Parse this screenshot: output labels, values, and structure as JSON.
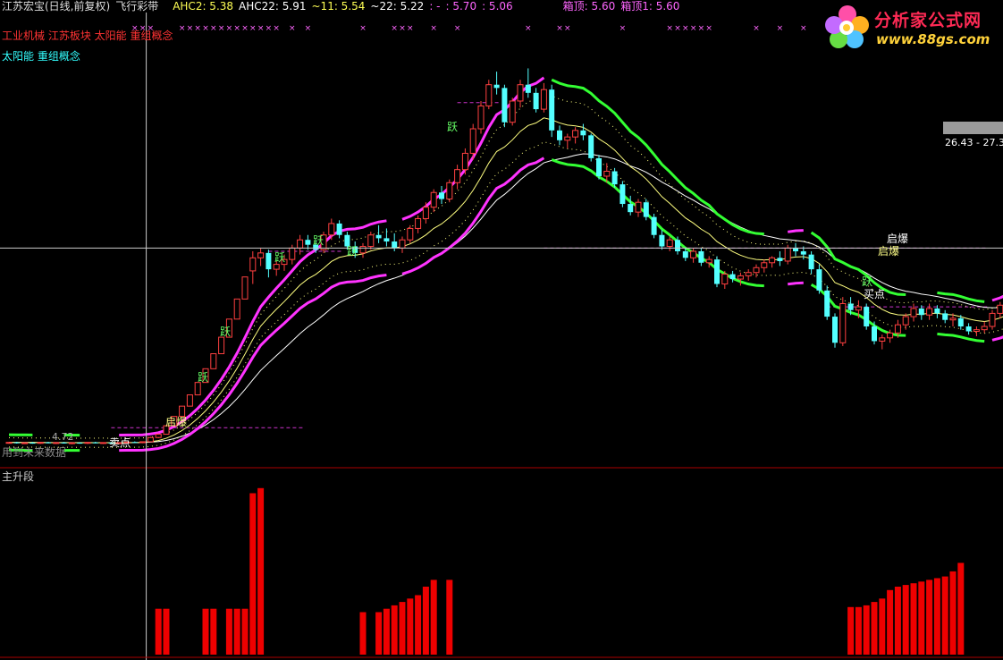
{
  "header": {
    "title": "江苏宏宝(日线,前复权)",
    "indicator": "飞行彩带",
    "ahc2": "AHC2: 5.38",
    "ahc22": "AHC22: 5.91",
    "v11": "~11: 5.54",
    "v22": "~22: 5.22",
    "dash1": ": -",
    "val570": ": 5.70",
    "val506": ": 5.06",
    "box_top": "箱顶: 5.60",
    "box_top1": "箱顶1: 5.60"
  },
  "concepts": {
    "line1": "工业机械 江苏板块 太阳能 重组概念",
    "line2": "太阳能 重组概念"
  },
  "notes": {
    "future_data": "用到未来数据",
    "start_price": "4.72",
    "price_range": "26.43 - 27.3"
  },
  "signals": {
    "jump": "跃",
    "start_burst": "启爆",
    "buy_point": "买点",
    "sell_point": "卖点"
  },
  "sub_panel": {
    "title": "主升段"
  },
  "logo": {
    "name": "分析家公式网",
    "url": "www.88gs.com"
  },
  "colors": {
    "background": "#000000",
    "up_candle": "#ff4040",
    "down_candle": "#54ffff",
    "band_upper": "#ff33ff",
    "band_fast": "#ffff80",
    "band_slow": "#ffffff",
    "band_green": "#33ff33",
    "bars": "#ee0000",
    "box_line": "#cc33cc"
  },
  "chart_data": {
    "type": "candlestick",
    "x_count": 125,
    "ylim": [
      4.3,
      28.5
    ],
    "ohlc": [
      [
        4.65,
        4.72,
        4.62,
        4.7
      ],
      [
        4.7,
        4.74,
        4.63,
        4.66
      ],
      [
        4.66,
        4.72,
        4.6,
        4.68
      ],
      [
        4.68,
        4.73,
        4.62,
        4.67
      ],
      [
        4.67,
        4.72,
        4.61,
        4.7
      ],
      [
        4.7,
        4.74,
        4.64,
        4.66
      ],
      [
        4.66,
        4.71,
        4.6,
        4.69
      ],
      [
        4.69,
        4.73,
        4.63,
        4.65
      ],
      [
        4.65,
        4.7,
        4.59,
        4.68
      ],
      [
        4.68,
        4.72,
        4.62,
        4.66
      ],
      [
        4.66,
        4.71,
        4.6,
        4.7
      ],
      [
        4.7,
        4.74,
        4.64,
        4.67
      ],
      [
        4.67,
        4.71,
        4.61,
        4.69
      ],
      [
        4.69,
        4.73,
        4.63,
        4.66
      ],
      [
        4.66,
        4.7,
        4.6,
        4.68
      ],
      [
        4.68,
        4.72,
        4.62,
        4.72
      ],
      [
        4.72,
        4.76,
        4.66,
        4.7
      ],
      [
        4.7,
        4.75,
        4.65,
        4.74
      ],
      [
        4.74,
        5.05,
        4.72,
        5.0
      ],
      [
        5.0,
        5.25,
        4.96,
        5.2
      ],
      [
        5.2,
        5.72,
        5.18,
        5.72
      ],
      [
        5.72,
        6.29,
        5.72,
        6.29
      ],
      [
        6.29,
        6.92,
        6.29,
        6.92
      ],
      [
        6.92,
        7.61,
        6.92,
        7.61
      ],
      [
        7.61,
        8.37,
        7.61,
        8.37
      ],
      [
        8.37,
        9.21,
        8.37,
        9.21
      ],
      [
        9.21,
        10.13,
        9.21,
        10.13
      ],
      [
        10.13,
        11.14,
        10.13,
        11.14
      ],
      [
        11.14,
        12.25,
        11.14,
        12.25
      ],
      [
        12.25,
        13.48,
        12.25,
        13.48
      ],
      [
        13.48,
        14.83,
        13.48,
        14.83
      ],
      [
        15.2,
        16.4,
        14.4,
        16.0
      ],
      [
        16.0,
        16.6,
        15.5,
        16.3
      ],
      [
        16.3,
        16.5,
        14.8,
        15.3
      ],
      [
        15.3,
        15.8,
        14.9,
        15.6
      ],
      [
        15.6,
        16.2,
        15.2,
        15.9
      ],
      [
        15.9,
        16.8,
        15.6,
        16.6
      ],
      [
        16.6,
        17.4,
        16.2,
        17.1
      ],
      [
        17.1,
        17.4,
        16.5,
        16.8
      ],
      [
        16.8,
        17.1,
        16.3,
        16.5
      ],
      [
        16.5,
        17.6,
        16.3,
        17.4
      ],
      [
        17.4,
        18.4,
        17.1,
        18.1
      ],
      [
        18.1,
        18.3,
        17.2,
        17.4
      ],
      [
        17.4,
        17.6,
        16.5,
        16.7
      ],
      [
        16.7,
        17.0,
        16.0,
        16.3
      ],
      [
        16.3,
        16.9,
        16.0,
        16.7
      ],
      [
        16.7,
        17.6,
        16.5,
        17.4
      ],
      [
        17.4,
        18.0,
        16.9,
        17.2
      ],
      [
        17.2,
        17.8,
        16.7,
        17.0
      ],
      [
        17.0,
        17.5,
        16.4,
        16.6
      ],
      [
        16.6,
        17.3,
        16.3,
        17.1
      ],
      [
        17.1,
        18.0,
        16.9,
        17.8
      ],
      [
        17.8,
        18.6,
        17.5,
        18.4
      ],
      [
        18.4,
        19.4,
        18.1,
        19.1
      ],
      [
        19.1,
        20.2,
        18.8,
        20.0
      ],
      [
        20.0,
        20.4,
        19.3,
        19.6
      ],
      [
        19.6,
        20.8,
        19.4,
        20.6
      ],
      [
        20.6,
        21.7,
        20.2,
        21.4
      ],
      [
        21.4,
        22.7,
        21.1,
        22.4
      ],
      [
        22.4,
        24.2,
        22.0,
        23.9
      ],
      [
        23.9,
        25.6,
        23.6,
        25.3
      ],
      [
        25.3,
        26.9,
        25.1,
        26.6
      ],
      [
        26.6,
        27.4,
        26.0,
        26.4
      ],
      [
        26.4,
        26.6,
        24.0,
        24.3
      ],
      [
        24.3,
        25.8,
        24.1,
        25.6
      ],
      [
        25.6,
        26.9,
        25.2,
        26.6
      ],
      [
        26.6,
        27.6,
        25.8,
        26.1
      ],
      [
        26.1,
        26.4,
        24.9,
        25.1
      ],
      [
        25.1,
        26.7,
        24.9,
        26.3
      ],
      [
        26.3,
        26.6,
        23.4,
        23.8
      ],
      [
        23.8,
        24.1,
        22.9,
        23.2
      ],
      [
        23.2,
        23.6,
        22.7,
        23.4
      ],
      [
        23.4,
        24.0,
        23.0,
        23.8
      ],
      [
        23.8,
        24.2,
        23.2,
        23.5
      ],
      [
        23.5,
        23.6,
        21.9,
        22.1
      ],
      [
        22.1,
        22.3,
        20.8,
        21.0
      ],
      [
        21.0,
        21.8,
        20.6,
        21.3
      ],
      [
        21.3,
        21.5,
        20.3,
        20.5
      ],
      [
        20.5,
        20.7,
        19.1,
        19.3
      ],
      [
        19.3,
        19.8,
        18.6,
        18.8
      ],
      [
        18.8,
        19.6,
        18.5,
        19.4
      ],
      [
        19.4,
        19.6,
        18.3,
        18.5
      ],
      [
        18.5,
        18.7,
        17.2,
        17.4
      ],
      [
        17.4,
        17.7,
        16.5,
        16.7
      ],
      [
        16.7,
        17.3,
        16.4,
        17.1
      ],
      [
        17.1,
        17.3,
        16.2,
        16.4
      ],
      [
        16.4,
        16.6,
        15.8,
        16.0
      ],
      [
        16.0,
        16.6,
        15.7,
        16.4
      ],
      [
        16.4,
        16.6,
        15.5,
        15.7
      ],
      [
        15.7,
        16.1,
        15.4,
        15.9
      ],
      [
        15.9,
        16.1,
        14.2,
        14.4
      ],
      [
        14.4,
        15.2,
        14.1,
        15.0
      ],
      [
        15.0,
        15.2,
        14.5,
        14.7
      ],
      [
        14.7,
        15.1,
        14.3,
        14.9
      ],
      [
        14.9,
        15.3,
        14.6,
        15.1
      ],
      [
        15.1,
        15.6,
        14.8,
        15.4
      ],
      [
        15.4,
        15.9,
        15.1,
        15.7
      ],
      [
        15.7,
        16.1,
        15.4,
        16.0
      ],
      [
        16.0,
        16.4,
        15.5,
        15.8
      ],
      [
        15.8,
        16.8,
        15.6,
        16.6
      ],
      [
        16.6,
        16.9,
        16.1,
        16.4
      ],
      [
        16.4,
        16.7,
        15.9,
        16.2
      ],
      [
        16.2,
        16.4,
        15.0,
        15.3
      ],
      [
        15.3,
        15.6,
        13.8,
        14.0
      ],
      [
        14.0,
        14.3,
        12.2,
        12.4
      ],
      [
        12.4,
        12.6,
        10.5,
        10.8
      ],
      [
        10.8,
        13.6,
        10.6,
        13.2
      ],
      [
        13.2,
        13.6,
        12.5,
        12.8
      ],
      [
        12.8,
        13.4,
        12.3,
        13.0
      ],
      [
        13.0,
        13.2,
        11.6,
        11.8
      ],
      [
        11.8,
        12.1,
        10.7,
        10.9
      ],
      [
        10.9,
        11.3,
        10.4,
        11.1
      ],
      [
        11.1,
        11.6,
        10.8,
        11.4
      ],
      [
        11.4,
        12.2,
        11.1,
        11.9
      ],
      [
        11.9,
        12.6,
        11.6,
        12.4
      ],
      [
        12.4,
        13.2,
        12.1,
        12.9
      ],
      [
        12.9,
        13.1,
        12.2,
        12.5
      ],
      [
        12.5,
        13.2,
        12.2,
        12.9
      ],
      [
        12.9,
        13.1,
        12.3,
        12.6
      ],
      [
        12.6,
        12.8,
        12.0,
        12.2
      ],
      [
        12.2,
        12.6,
        11.8,
        12.3
      ],
      [
        12.3,
        12.5,
        11.6,
        11.8
      ],
      [
        11.8,
        12.0,
        11.3,
        11.5
      ],
      [
        11.5,
        11.8,
        11.2,
        11.6
      ],
      [
        11.6,
        12.1,
        11.4,
        11.8
      ],
      [
        11.8,
        12.8,
        11.6,
        12.6
      ],
      [
        12.6,
        13.3,
        12.3,
        13.1
      ],
      [
        13.1,
        13.9,
        12.9,
        13.6
      ],
      [
        13.6,
        14.8,
        13.4,
        14.5
      ]
    ],
    "box_levels": [
      {
        "value": 5.6,
        "from": 13,
        "to": 37
      },
      {
        "value": 16.4,
        "from": 33,
        "to": 42
      },
      {
        "value": 25.5,
        "from": 57,
        "to": 62
      },
      {
        "value": 16.6,
        "from": 68,
        "to": 124
      },
      {
        "value": 13.0,
        "from": 104,
        "to": 124
      }
    ],
    "sub_bars": [
      {
        "i": 19,
        "v": 0.27
      },
      {
        "i": 20,
        "v": 0.27
      },
      {
        "i": 25,
        "v": 0.27
      },
      {
        "i": 26,
        "v": 0.27
      },
      {
        "i": 28,
        "v": 0.27
      },
      {
        "i": 29,
        "v": 0.27
      },
      {
        "i": 30,
        "v": 0.27
      },
      {
        "i": 31,
        "v": 0.95
      },
      {
        "i": 32,
        "v": 0.98
      },
      {
        "i": 45,
        "v": 0.25
      },
      {
        "i": 47,
        "v": 0.25
      },
      {
        "i": 48,
        "v": 0.27
      },
      {
        "i": 49,
        "v": 0.29
      },
      {
        "i": 50,
        "v": 0.31
      },
      {
        "i": 51,
        "v": 0.33
      },
      {
        "i": 52,
        "v": 0.35
      },
      {
        "i": 53,
        "v": 0.4
      },
      {
        "i": 54,
        "v": 0.44
      },
      {
        "i": 56,
        "v": 0.44
      },
      {
        "i": 107,
        "v": 0.28
      },
      {
        "i": 108,
        "v": 0.28
      },
      {
        "i": 109,
        "v": 0.29
      },
      {
        "i": 110,
        "v": 0.31
      },
      {
        "i": 111,
        "v": 0.33
      },
      {
        "i": 112,
        "v": 0.38
      },
      {
        "i": 113,
        "v": 0.4
      },
      {
        "i": 114,
        "v": 0.41
      },
      {
        "i": 115,
        "v": 0.42
      },
      {
        "i": 116,
        "v": 0.43
      },
      {
        "i": 117,
        "v": 0.44
      },
      {
        "i": 118,
        "v": 0.45
      },
      {
        "i": 119,
        "v": 0.46
      },
      {
        "i": 120,
        "v": 0.49
      },
      {
        "i": 121,
        "v": 0.54
      }
    ],
    "signals": [
      {
        "i": 13,
        "label": "卖点"
      },
      {
        "i": 20,
        "label": "启爆"
      },
      {
        "i": 24,
        "label": "跃"
      },
      {
        "i": 27,
        "label": "跃"
      },
      {
        "i": 35,
        "label": "跃"
      },
      {
        "i": 40,
        "label": "跃"
      },
      {
        "i": 43,
        "label": "跃"
      },
      {
        "i": 56,
        "label": "跃"
      },
      {
        "i": 107,
        "label": "买点"
      },
      {
        "i": 106,
        "label": "跃"
      },
      {
        "i": 109,
        "label": "启爆"
      },
      {
        "i": 110,
        "label": "启爆"
      }
    ],
    "crosshair": {
      "index": 17,
      "value": 16.6
    }
  }
}
